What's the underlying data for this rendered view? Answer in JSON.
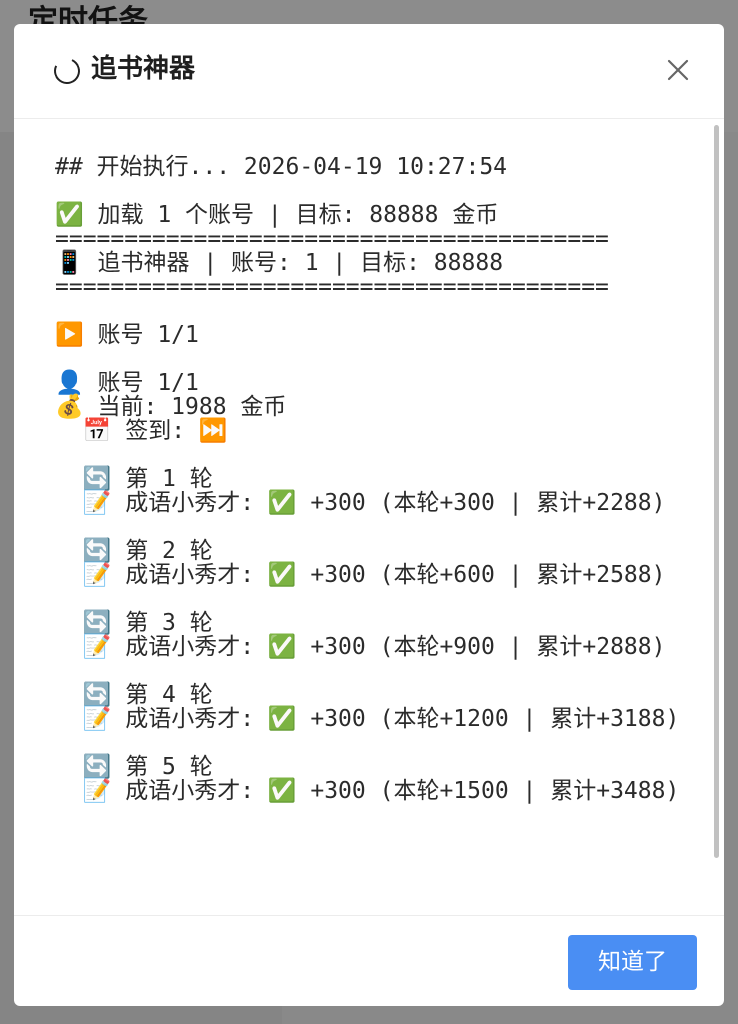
{
  "background": {
    "page_title": "定时任务"
  },
  "dialog": {
    "title": "追书神器",
    "close_icon": "close-icon",
    "spinner_icon": "loading-spinner-icon",
    "log_text": "## 开始执行... 2026-04-19 10:27:54\n\n✅ 加载 1 个账号 | 目标: 88888 金币\n========================================\n📱 追书神器 | 账号: 1 | 目标: 88888\n========================================\n\n▶️ 账号 1/1\n\n👤 账号 1/1\n💰 当前: 1988 金币\n  📅 签到: ⏭️\n\n  🔄 第 1 轮\n  📝 成语小秀才: ✅ +300 (本轮+300 | 累计+2288)\n\n  🔄 第 2 轮\n  📝 成语小秀才: ✅ +300 (本轮+600 | 累计+2588)\n\n  🔄 第 3 轮\n  📝 成语小秀才: ✅ +300 (本轮+900 | 累计+2888)\n\n  🔄 第 4 轮\n  📝 成语小秀才: ✅ +300 (本轮+1200 | 累计+3188)\n\n  🔄 第 5 轮\n  📝 成语小秀才: ✅ +300 (本轮+1500 | 累计+3488)",
    "ok_label": "知道了"
  },
  "colors": {
    "primary_button": "#4a8ef3",
    "overlay": "rgba(0,0,0,0.45)"
  }
}
